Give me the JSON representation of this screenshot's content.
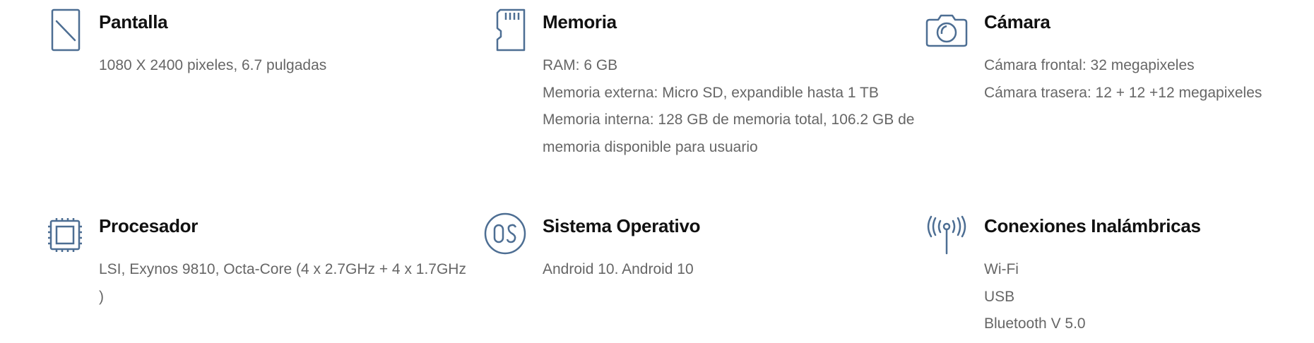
{
  "icon_color": "#4d6e93",
  "specs": [
    {
      "icon": "screen-icon",
      "title": "Pantalla",
      "lines": [
        "1080 X 2400 pixeles, 6.7 pulgadas"
      ]
    },
    {
      "icon": "memory-card-icon",
      "title": "Memoria",
      "lines": [
        "RAM: 6 GB",
        "Memoria externa: Micro SD, expandible hasta 1 TB",
        "Memoria interna: 128 GB de memoria total, 106.2 GB de memoria disponible para usuario"
      ]
    },
    {
      "icon": "camera-icon",
      "title": "Cámara",
      "lines": [
        "Cámara frontal: 32 megapixeles",
        "Cámara trasera: 12 + 12 +12 megapixeles"
      ]
    },
    {
      "icon": "processor-icon",
      "title": "Procesador",
      "lines": [
        "LSI, Exynos 9810, Octa-Core (4 x 2.7GHz + 4 x 1.7GHz )"
      ]
    },
    {
      "icon": "os-icon",
      "title": "Sistema Operativo",
      "lines": [
        "Android 10. Android 10"
      ]
    },
    {
      "icon": "antenna-icon",
      "title": "Conexiones Inalámbricas",
      "lines": [
        "Wi-Fi",
        "USB",
        "Bluetooth V 5.0"
      ]
    }
  ]
}
